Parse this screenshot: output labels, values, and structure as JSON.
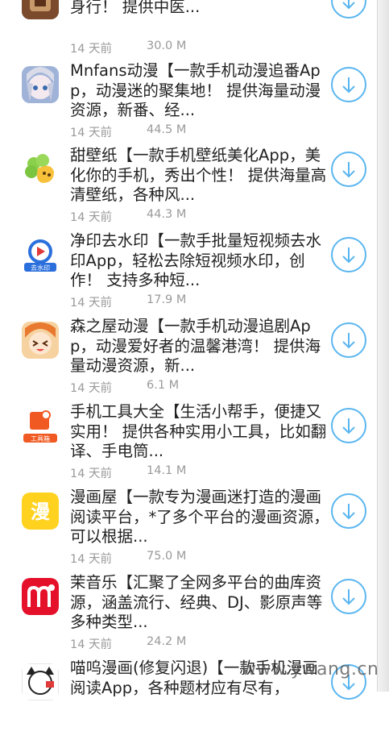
{
  "apps": [
    {
      "desc": "典籍App，中医爱好者必备，健康随身行！ 提供中医...",
      "time": "14 天前",
      "size": "30.0 M",
      "icon": "tcm-book-icon"
    },
    {
      "desc": "Mnfans动漫【一款手机动漫追番App，动漫迷的聚集地！ 提供海量动漫资源，新番、经...",
      "time": "14 天前",
      "size": "44.5 M",
      "icon": "anime-girl-icon"
    },
    {
      "desc": "甜壁纸【一款手机壁纸美化App，美化你的手机，秀出个性！ 提供海量高清壁纸，各种风...",
      "time": "14 天前",
      "size": "44.3 M",
      "icon": "wallpaper-leaf-icon"
    },
    {
      "desc": "净印去水印【一款手批量短视频去水印App，轻松去除短视频水印，创作！ 支持多种短...",
      "time": "14 天前",
      "size": "17.9 M",
      "icon": "watermark-remover-icon"
    },
    {
      "desc": "森之屋动漫【一款手机动漫追剧App，动漫爱好者的温馨港湾！ 提供海量动漫资源，新...",
      "time": "14 天前",
      "size": "6.1 M",
      "icon": "anime-chibi-icon"
    },
    {
      "desc": "手机工具大全【生活小帮手，便捷又实用！ 提供各种实用小工具，比如翻译、手电筒...",
      "time": "14 天前",
      "size": "14.1 M",
      "icon": "toolbox-icon"
    },
    {
      "desc": "漫画屋【一款专为漫画迷打造的漫画阅读平台，*了多个平台的漫画资源，可以根据...",
      "time": "14 天前",
      "size": "75.0 M",
      "icon": "manga-icon"
    },
    {
      "desc": "茉音乐【汇聚了全网多平台的曲库资源，涵盖流行、经典、DJ、影原声等多种类型...",
      "time": "14 天前",
      "size": "24.2 M",
      "icon": "music-m-icon"
    },
    {
      "desc": "喵呜漫画(修复闪退)【一款手机漫画阅读App，各种题材应有尽有，",
      "time": "",
      "size": "",
      "icon": "cat-manga-icon"
    }
  ],
  "icon_img_labels": {
    "watermark_badge": "去水印",
    "tool_badge": "工具箱",
    "manga_char": "漫"
  },
  "download_icon": "download-circle-icon",
  "watermark": "www.ywang.cn",
  "colors": {
    "accent": "#5ab6f0",
    "meta": "#9a9a9a",
    "text": "#222222"
  }
}
